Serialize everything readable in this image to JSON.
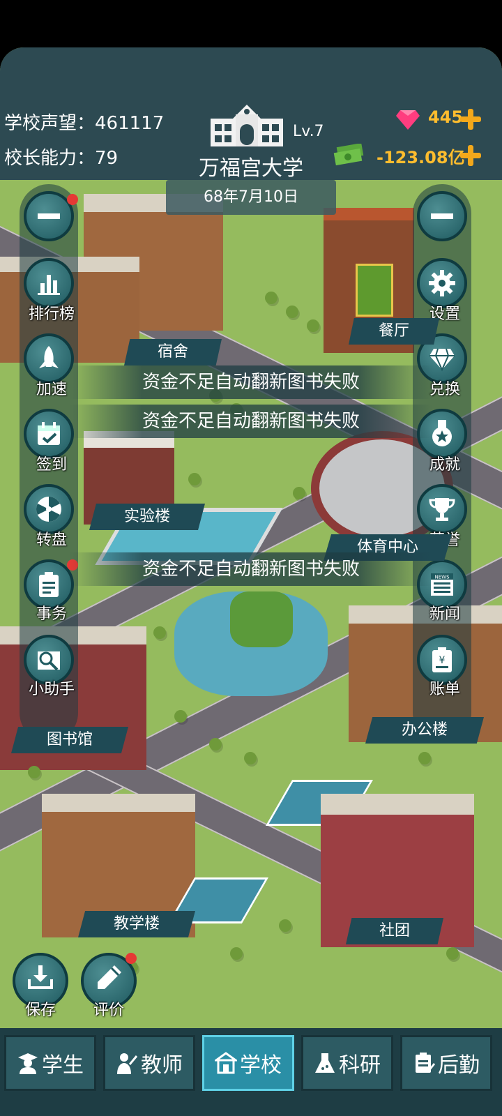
{
  "header": {
    "reputation_label": "学校声望：",
    "reputation_value": "461117",
    "ability_label": "校长能力：",
    "ability_value": "79",
    "school_name": "万福宫大学",
    "level": "Lv.7",
    "gems": "445",
    "money": "-123.08亿",
    "date": "68年7月10日"
  },
  "left_menu": [
    {
      "label": "排行榜",
      "icon": "chart-icon"
    },
    {
      "label": "加速",
      "icon": "rocket-icon"
    },
    {
      "label": "签到",
      "icon": "calendar-icon"
    },
    {
      "label": "转盘",
      "icon": "wheel-icon"
    },
    {
      "label": "事务",
      "icon": "clipboard-icon"
    },
    {
      "label": "小助手",
      "icon": "magnifier-book-icon"
    }
  ],
  "right_menu": [
    {
      "label": "设置",
      "icon": "gear-icon"
    },
    {
      "label": "兑换",
      "icon": "diamond-icon"
    },
    {
      "label": "成就",
      "icon": "medal-icon"
    },
    {
      "label": "荣誉",
      "icon": "trophy-icon"
    },
    {
      "label": "新闻",
      "icon": "newspaper-icon"
    },
    {
      "label": "账单",
      "icon": "bill-icon"
    }
  ],
  "newspaper_text": "NEWS",
  "bill_symbol": "¥",
  "buildings": {
    "dorm": "宿舍",
    "canteen": "餐厅",
    "lab": "实验楼",
    "sports": "体育中心",
    "library": "图书馆",
    "office": "办公楼",
    "teaching": "教学楼",
    "club": "社团"
  },
  "toasts": [
    "资金不足自动翻新图书失败",
    "资金不足自动翻新图书失败",
    "资金不足自动翻新图书失败"
  ],
  "bottom_left": [
    {
      "label": "保存",
      "icon": "download-icon"
    },
    {
      "label": "评价",
      "icon": "pencil-icon"
    }
  ],
  "tabs": [
    {
      "label": "学生",
      "icon": "student-icon"
    },
    {
      "label": "教师",
      "icon": "teacher-icon"
    },
    {
      "label": "学校",
      "icon": "school-icon",
      "active": true
    },
    {
      "label": "科研",
      "icon": "flask-icon"
    },
    {
      "label": "后勤",
      "icon": "logistics-icon"
    }
  ]
}
